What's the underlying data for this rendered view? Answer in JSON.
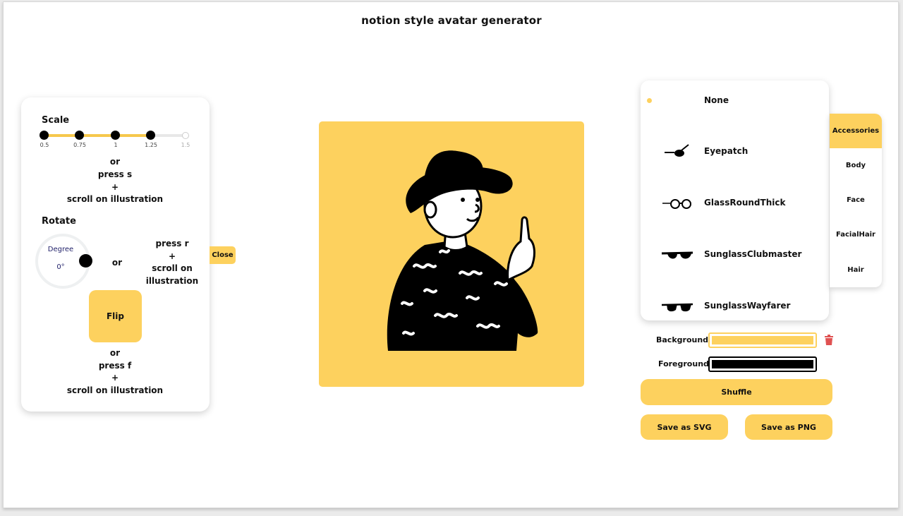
{
  "app": {
    "title": "notion style avatar generator"
  },
  "colors": {
    "accent": "#fdd15e",
    "background_swatch": "#fdd15e",
    "foreground_swatch": "#000000",
    "trash": "#e05252"
  },
  "scale": {
    "label": "Scale",
    "ticks": [
      "0.5",
      "0.75",
      "1",
      "1.25",
      "1.5"
    ],
    "selected": "1.25",
    "hint_or": "or",
    "hint_key": "press s",
    "hint_plus": "+",
    "hint_scroll": "scroll on illustration"
  },
  "rotate": {
    "label": "Rotate",
    "dial_title": "Degree",
    "dial_value": "0°",
    "hint_or": "or",
    "hint_key": "press r",
    "hint_plus": "+",
    "hint_scroll_1": "scroll on",
    "hint_scroll_2": "illustration"
  },
  "flip": {
    "button_label": "Flip",
    "hint_or": "or",
    "hint_key": "press f",
    "hint_plus": "+",
    "hint_scroll": "scroll on illustration"
  },
  "close_label": "Close",
  "options": [
    {
      "label": "None",
      "icon": "none",
      "selected": true
    },
    {
      "label": "Eyepatch",
      "icon": "eyepatch-icon"
    },
    {
      "label": "GlassRoundThick",
      "icon": "round-glasses-icon"
    },
    {
      "label": "SunglassClubmaster",
      "icon": "clubmaster-sunglasses-icon"
    },
    {
      "label": "SunglassWayfarer",
      "icon": "wayfarer-sunglasses-icon"
    }
  ],
  "categories": [
    {
      "label": "Accessories",
      "active": true
    },
    {
      "label": "Body"
    },
    {
      "label": "Face"
    },
    {
      "label": "FacialHair"
    },
    {
      "label": "Hair"
    }
  ],
  "colors_section": {
    "background_label": "Background",
    "foreground_label": "Foreground"
  },
  "actions": {
    "shuffle": "Shuffle",
    "save_svg": "Save as SVG",
    "save_png": "Save as PNG"
  }
}
